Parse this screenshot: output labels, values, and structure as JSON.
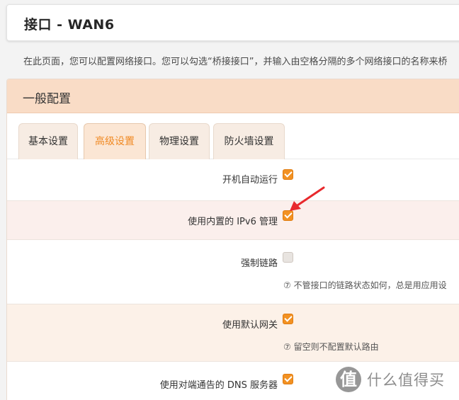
{
  "header": {
    "title": "接口 - WAN6"
  },
  "description": "在此页面，您可以配置网络接口。您可以勾选“桥接接口”，并输入由空格分隔的多个网络接口的名称来桥",
  "panel": {
    "title": "一般配置"
  },
  "tabs": [
    {
      "label": "基本设置",
      "active": false
    },
    {
      "label": "高级设置",
      "active": true
    },
    {
      "label": "物理设置",
      "active": false
    },
    {
      "label": "防火墙设置",
      "active": false
    }
  ],
  "options": [
    {
      "label": "开机自动运行",
      "checked": true,
      "hint": ""
    },
    {
      "label": "使用内置的 IPv6 管理",
      "checked": true,
      "hint": ""
    },
    {
      "label": "强制链路",
      "checked": false,
      "hint": "⑦ 不管接口的链路状态如何，总是用应用设"
    },
    {
      "label": "使用默认网关",
      "checked": true,
      "hint": "⑦ 留空则不配置默认路由"
    },
    {
      "label": "使用对端通告的 DNS 服务器",
      "checked": true,
      "hint": ""
    }
  ],
  "watermark": {
    "badge": "值",
    "text": "什么值得买"
  },
  "colors": {
    "accent": "#f29122",
    "header_bg": "#f9dcc6",
    "arrow": "#e8282c"
  }
}
